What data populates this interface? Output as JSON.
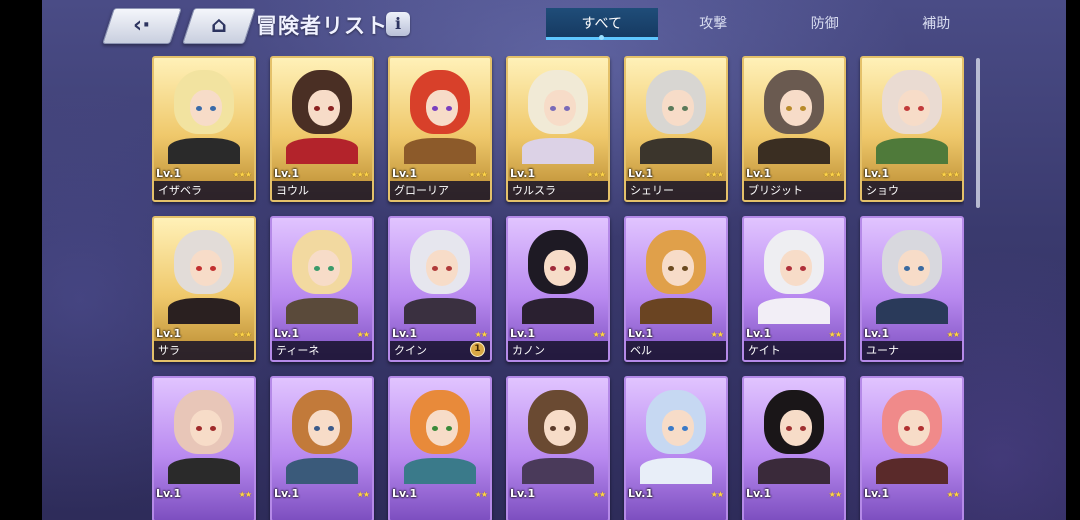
{
  "header": {
    "title": "冒険者リスト",
    "back_icon": "back-arrow-icon",
    "home_icon": "home-icon",
    "info_label": "i"
  },
  "tabs": [
    {
      "label": "すべて",
      "active": true
    },
    {
      "label": "攻撃",
      "active": false
    },
    {
      "label": "防御",
      "active": false
    },
    {
      "label": "補助",
      "active": false
    }
  ],
  "cards": [
    {
      "name": "イザベラ",
      "level": "Lv.1",
      "stars": 3,
      "rarity": "gold",
      "hair": "#f2e3a0",
      "eyes": "#3a6aa8",
      "outfit": "#2a2a2a"
    },
    {
      "name": "ヨウル",
      "level": "Lv.1",
      "stars": 3,
      "rarity": "gold",
      "hair": "#4a2f24",
      "eyes": "#8a2020",
      "outfit": "#b3232b"
    },
    {
      "name": "グローリア",
      "level": "Lv.1",
      "stars": 3,
      "rarity": "gold",
      "hair": "#d8402a",
      "eyes": "#7a3fbf",
      "outfit": "#8c5a2a"
    },
    {
      "name": "ウルスラ",
      "level": "Lv.1",
      "stars": 3,
      "rarity": "gold",
      "hair": "#f1ead6",
      "eyes": "#7a6ab8",
      "outfit": "#dcd2e6"
    },
    {
      "name": "シェリー",
      "level": "Lv.1",
      "stars": 3,
      "rarity": "gold",
      "hair": "#d8d6d2",
      "eyes": "#5a7a5a",
      "outfit": "#3b352c"
    },
    {
      "name": "ブリジット",
      "level": "Lv.1",
      "stars": 3,
      "rarity": "gold",
      "hair": "#6a5a50",
      "eyes": "#b88a2a",
      "outfit": "#3a2e22"
    },
    {
      "name": "ショウ",
      "level": "Lv.1",
      "stars": 3,
      "rarity": "gold",
      "hair": "#eadbd2",
      "eyes": "#c23a3a",
      "outfit": "#4f7a3a"
    },
    {
      "name": "サラ",
      "level": "Lv.1",
      "stars": 3,
      "rarity": "gold",
      "hair": "#e2dcd8",
      "eyes": "#c23030",
      "outfit": "#2a2020"
    },
    {
      "name": "ティーネ",
      "level": "Lv.1",
      "stars": 2,
      "rarity": "purple",
      "hair": "#f2d9a0",
      "eyes": "#3a9a6a",
      "outfit": "#5a4a3a"
    },
    {
      "name": "クイン",
      "level": "Lv.1",
      "stars": 2,
      "rarity": "purple",
      "hair": "#e6e6ee",
      "eyes": "#b03a3a",
      "outfit": "#3a3040",
      "badge": "1"
    },
    {
      "name": "カノン",
      "level": "Lv.1",
      "stars": 2,
      "rarity": "purple",
      "hair": "#1e1a24",
      "eyes": "#a02a3a",
      "outfit": "#2a2030"
    },
    {
      "name": "ベル",
      "level": "Lv.1",
      "stars": 2,
      "rarity": "purple",
      "hair": "#e0a04a",
      "eyes": "#6a4a20",
      "outfit": "#6a4422"
    },
    {
      "name": "ケイト",
      "level": "Lv.1",
      "stars": 2,
      "rarity": "purple",
      "hair": "#eeeef2",
      "eyes": "#b0303a",
      "outfit": "#f2eef6"
    },
    {
      "name": "ユーナ",
      "level": "Lv.1",
      "stars": 2,
      "rarity": "purple",
      "hair": "#d8d8de",
      "eyes": "#3a6aa0",
      "outfit": "#2a3a5a"
    },
    {
      "name": "",
      "level": "Lv.1",
      "stars": 2,
      "rarity": "purple",
      "hair": "#e8c6b8",
      "eyes": "#a02a2a",
      "outfit": "#2a2a2a"
    },
    {
      "name": "",
      "level": "Lv.1",
      "stars": 2,
      "rarity": "purple",
      "hair": "#c27a3a",
      "eyes": "#3a5a8a",
      "outfit": "#3a5a7a"
    },
    {
      "name": "",
      "level": "Lv.1",
      "stars": 2,
      "rarity": "purple",
      "hair": "#e88a3a",
      "eyes": "#3a8a3a",
      "outfit": "#3a7a8a"
    },
    {
      "name": "",
      "level": "Lv.1",
      "stars": 2,
      "rarity": "purple",
      "hair": "#6a4a32",
      "eyes": "#5a3a2a",
      "outfit": "#4a3a5a"
    },
    {
      "name": "",
      "level": "Lv.1",
      "stars": 2,
      "rarity": "purple",
      "hair": "#c6d8f2",
      "eyes": "#3a7ac8",
      "outfit": "#e8eef8"
    },
    {
      "name": "",
      "level": "Lv.1",
      "stars": 2,
      "rarity": "purple",
      "hair": "#1a1618",
      "eyes": "#a03030",
      "outfit": "#3a2a3a"
    },
    {
      "name": "",
      "level": "Lv.1",
      "stars": 2,
      "rarity": "purple",
      "hair": "#f08a8a",
      "eyes": "#b03030",
      "outfit": "#5a2a2a"
    }
  ]
}
